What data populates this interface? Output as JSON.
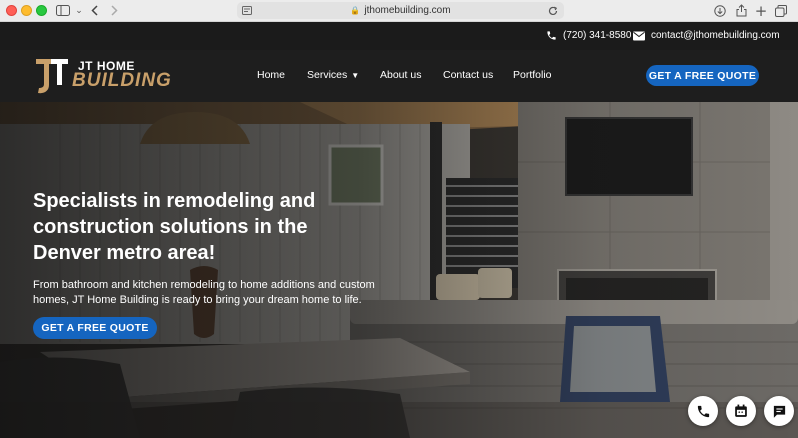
{
  "browser": {
    "url": "jthomebuilding.com",
    "icons": [
      "sidebar-icon",
      "back-icon",
      "forward-icon",
      "reader-icon",
      "lock-icon",
      "reload-icon",
      "download-icon",
      "share-icon",
      "new-tab-icon",
      "tabs-icon"
    ]
  },
  "topbar": {
    "phone": "(720) 341-8580",
    "email": "contact@jthomebuilding.com"
  },
  "logo": {
    "line1": "JT HOME",
    "line2": "BUILDING"
  },
  "nav": {
    "items": [
      "Home",
      "Services",
      "About us",
      "Contact us",
      "Portfolio"
    ],
    "cta": "GET A FREE QUOTE"
  },
  "hero": {
    "headline": "Specialists in remodeling and construction solutions in the Denver metro area!",
    "subtext": "From bathroom and kitchen remodeling to home additions and custom homes, JT Home Building is ready to bring your dream home to life.",
    "cta": "GET A FREE QUOTE"
  },
  "floating_buttons": [
    "phone-icon",
    "calendar-icon",
    "chat-icon"
  ],
  "colors": {
    "accent": "#1565c0",
    "logo_gold": "#c9a06a",
    "nav_bg": "#1e1e1e"
  }
}
